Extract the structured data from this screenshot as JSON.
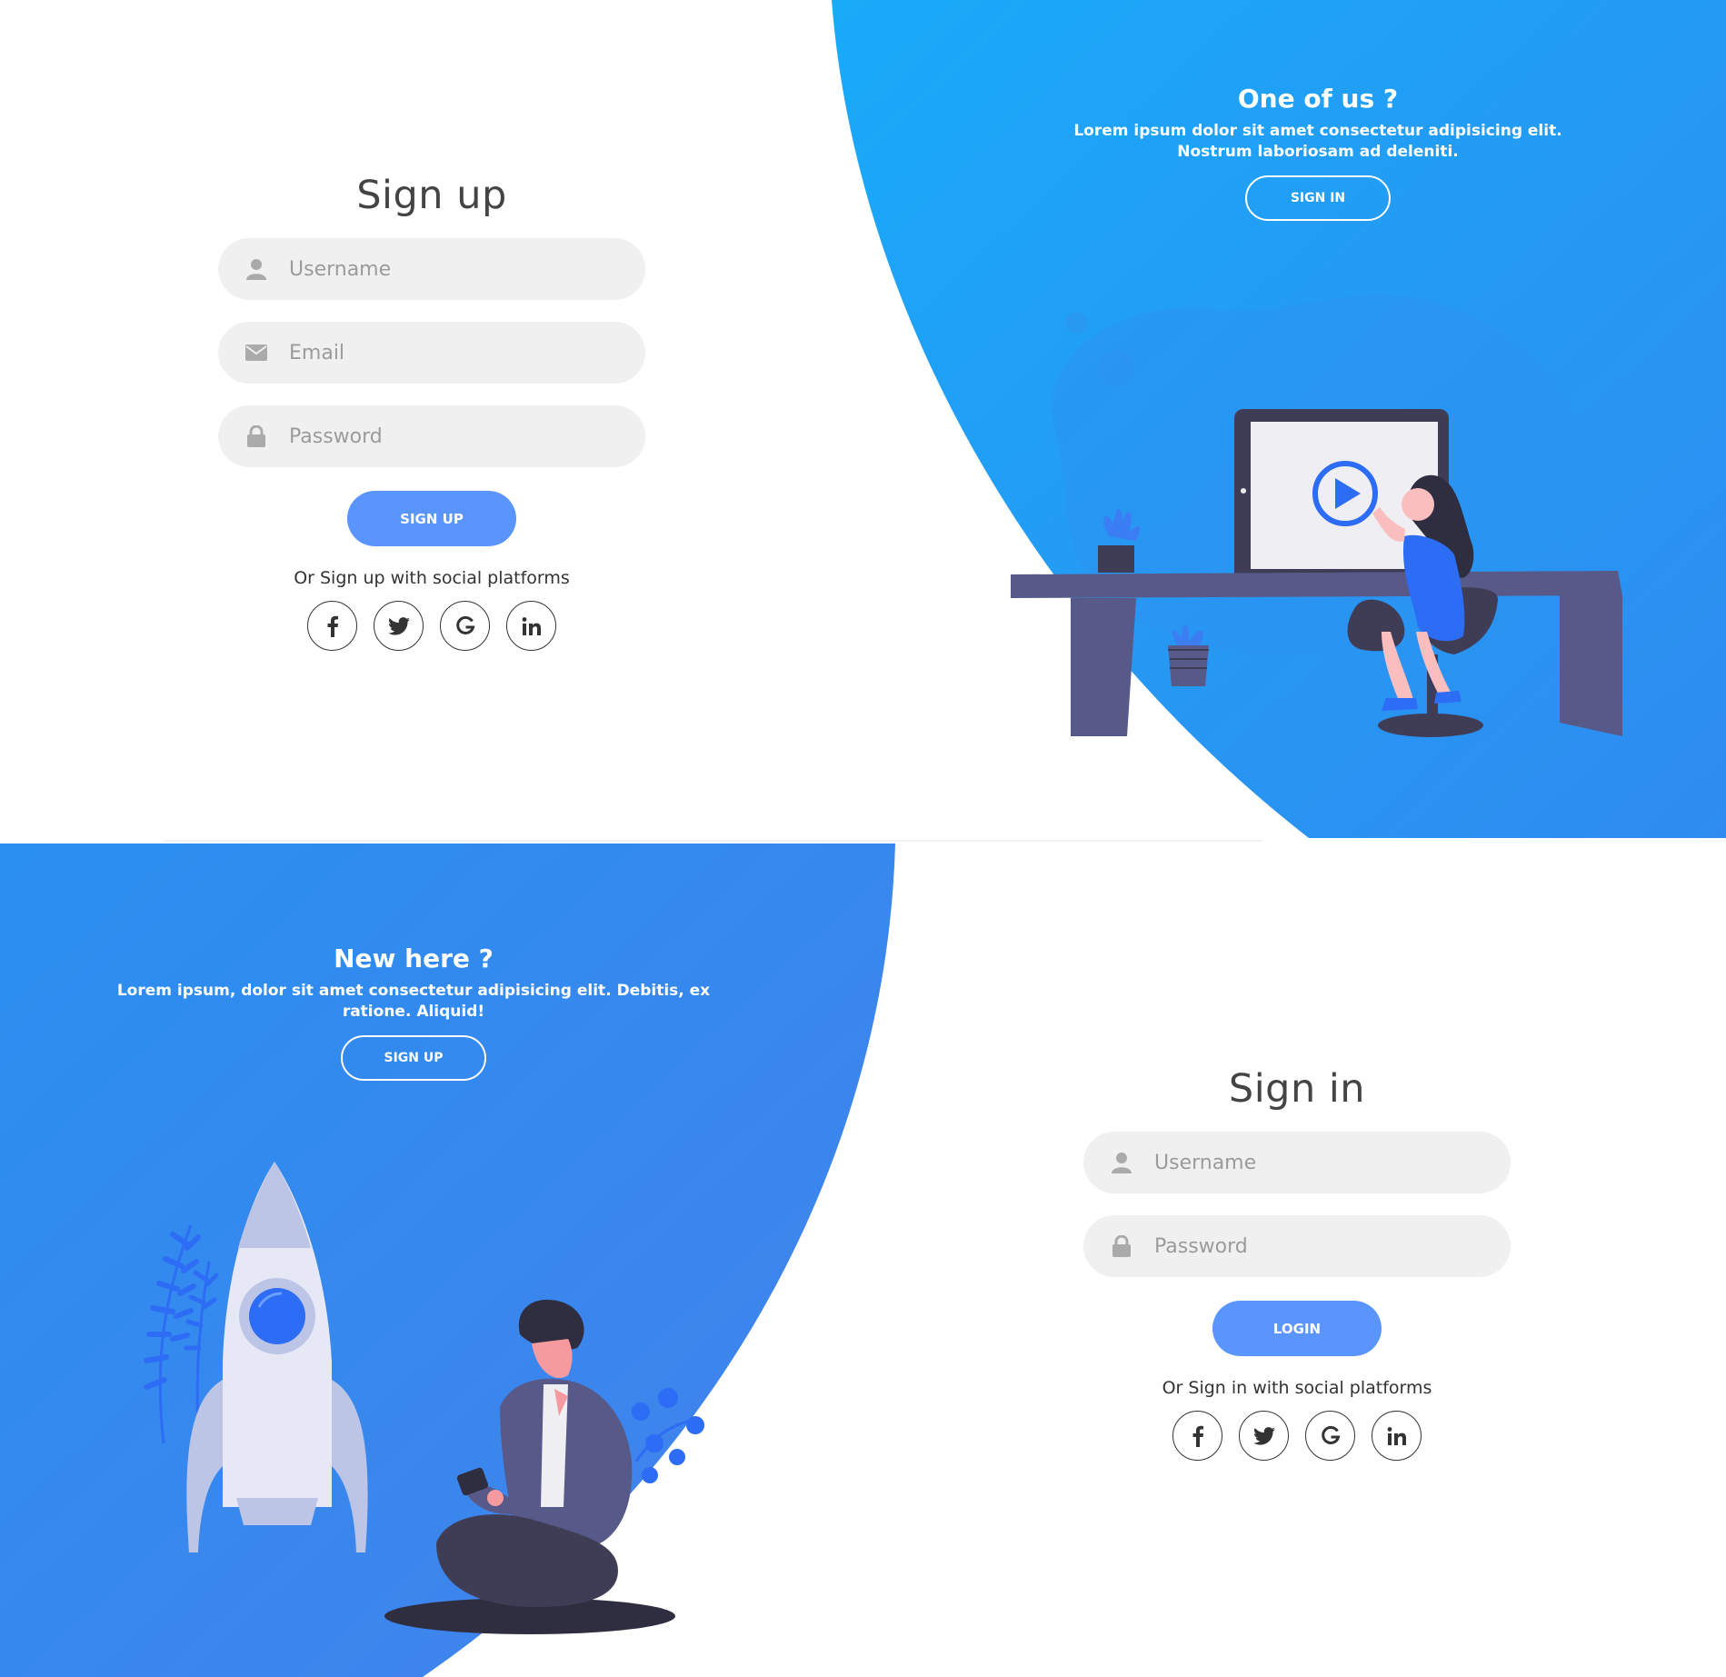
{
  "colors": {
    "primary_button": "#5995fd",
    "gradient_start": "#19aaf8",
    "gradient_end": "#4481eb",
    "input_bg": "#f0f0f0",
    "title_text": "#444444"
  },
  "signup_form": {
    "title": "Sign up",
    "username_placeholder": "Username",
    "email_placeholder": "Email",
    "password_placeholder": "Password",
    "submit_label": "SIGN UP",
    "social_text": "Or Sign up with social platforms",
    "social_icons": [
      "facebook-icon",
      "twitter-icon",
      "google-icon",
      "linkedin-icon"
    ]
  },
  "top_panel_content": {
    "heading": "One of us ?",
    "text": "Lorem ipsum dolor sit amet consectetur adipisicing elit. Nostrum laboriosam ad deleniti.",
    "button_label": "SIGN IN"
  },
  "bottom_panel_content": {
    "heading": "New here ?",
    "text": "Lorem ipsum, dolor sit amet consectetur adipisicing elit. Debitis, ex ratione. Aliquid!",
    "button_label": "SIGN UP"
  },
  "signin_form": {
    "title": "Sign in",
    "username_placeholder": "Username",
    "password_placeholder": "Password",
    "submit_label": "LOGIN",
    "social_text": "Or Sign in with social platforms",
    "social_icons": [
      "facebook-icon",
      "twitter-icon",
      "google-icon",
      "linkedin-icon"
    ]
  }
}
